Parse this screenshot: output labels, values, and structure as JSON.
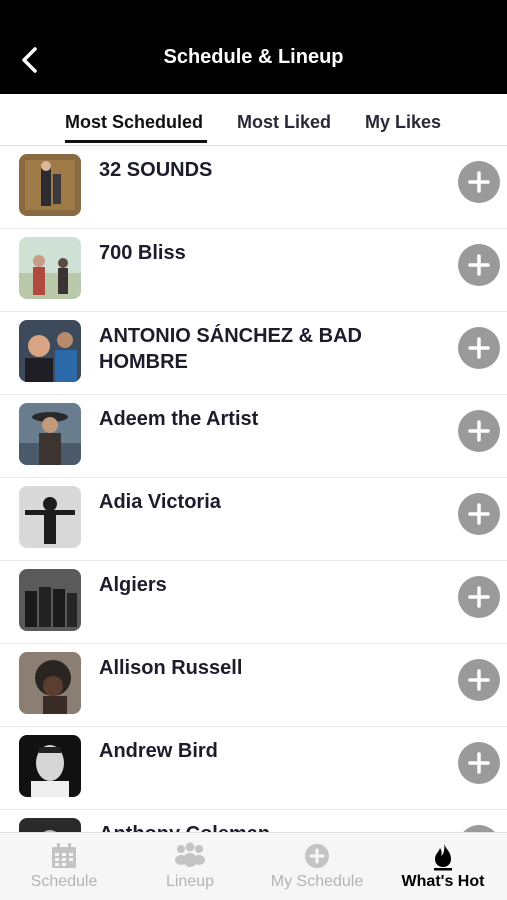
{
  "header": {
    "title": "Schedule & Lineup",
    "back_icon": "chevron-left-icon"
  },
  "tabs": [
    {
      "label": "Most Scheduled",
      "active": true
    },
    {
      "label": "Most Liked",
      "active": false
    },
    {
      "label": "My Likes",
      "active": false
    }
  ],
  "artists": [
    {
      "name": "32 SOUNDS"
    },
    {
      "name": "700 Bliss"
    },
    {
      "name": "ANTONIO SÁNCHEZ & BAD HOMBRE"
    },
    {
      "name": "Adeem the Artist"
    },
    {
      "name": "Adia Victoria"
    },
    {
      "name": "Algiers"
    },
    {
      "name": "Allison Russell"
    },
    {
      "name": "Andrew Bird"
    },
    {
      "name": "Anthony Coleman"
    }
  ],
  "add_icon": "plus-circle-icon",
  "tabbar": {
    "items": [
      {
        "label": "Schedule",
        "icon": "calendar-icon",
        "active": false
      },
      {
        "label": "Lineup",
        "icon": "people-icon",
        "active": false
      },
      {
        "label": "My Schedule",
        "icon": "plus-circle-icon",
        "active": false
      },
      {
        "label": "What's Hot",
        "icon": "flame-icon",
        "active": true
      }
    ]
  },
  "colors": {
    "header_bg": "#000000",
    "add_button": "#9a9a9a",
    "active_label": "#000000",
    "inactive_label": "#b4b4b4"
  }
}
